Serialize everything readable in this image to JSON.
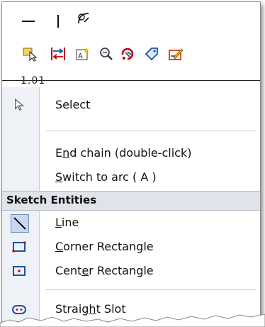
{
  "toolbar": {
    "icons": [
      "minimize-icon",
      "vertical-line-icon",
      "tangent-arc-icon",
      "select-tool-icon",
      "mirror-icon",
      "smart-dimension-icon",
      "zoom-icon",
      "rebuild-icon",
      "tag-icon",
      "sketch-edit-icon"
    ]
  },
  "cut_text": "1.01",
  "menu": {
    "select": "Select",
    "end_chain_pre": "E",
    "end_chain_u": "n",
    "end_chain_post": "d chain  (double-click)",
    "switch_arc_u": "S",
    "switch_arc_post": "witch to arc  ( A )",
    "section_title": "Sketch Entities",
    "line_u": "L",
    "line_post": "ine",
    "corner_u": "C",
    "corner_post": "orner Rectangle",
    "center_pre": "Cent",
    "center_u": "e",
    "center_post": "r Rectangle",
    "slot_pre": "Straig",
    "slot_u": "h",
    "slot_post": "t Slot"
  },
  "colors": {
    "accent": "#c00000",
    "selected_bg": "#c9d7ee",
    "gutter": "#eef1f6"
  }
}
